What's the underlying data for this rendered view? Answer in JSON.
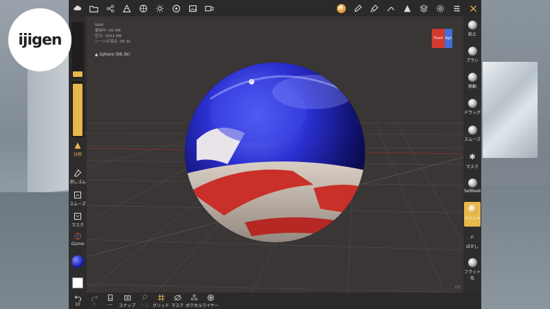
{
  "brand": {
    "logo_text": "ijigen"
  },
  "info": {
    "ram": "RAM",
    "used": "使用中: 66 MB",
    "free": "空き: 1652 MB",
    "scene_verts": "シーンの頂点: 98.3k",
    "scene_item": "Sphere (98.3k)"
  },
  "viewcube": {
    "front": "Front",
    "right": "Rgh"
  },
  "leftbar": {
    "symmetry": "対称",
    "eraser": "消しゴム",
    "smooth": "スムーズ",
    "mask": "マスク",
    "gizmo": "Gizmo"
  },
  "rightbar": {
    "items": [
      {
        "label": "粘土",
        "icon": "clay-ball-icon"
      },
      {
        "label": "ブラシ",
        "icon": "brush-ball-icon"
      },
      {
        "label": "移動",
        "icon": "move-ball-icon"
      },
      {
        "label": "ドラッグ",
        "icon": "drag-ball-icon"
      },
      {
        "label": "スムーズ",
        "icon": "smooth-ball-icon"
      },
      {
        "label": "マスク",
        "icon": "mask-icon"
      },
      {
        "label": "SelMask",
        "icon": "selmask-ball-icon"
      },
      {
        "label": "ペイント",
        "icon": "paint-ball-icon",
        "active": true
      },
      {
        "label": "ぼかし",
        "icon": "blur-icon"
      },
      {
        "label": "フラット化",
        "icon": "flatten-ball-icon"
      }
    ]
  },
  "bottombar": {
    "undo_count": "10",
    "redo_count": "0",
    "items": [
      "スナップ",
      "ソロ",
      "グリッド",
      "マスク",
      "ボクセル",
      "ワイヤー"
    ],
    "dash": "---"
  },
  "colors": {
    "accent": "#e7b94a",
    "panel": "#2e2c2c",
    "viewport": "#3a3636"
  },
  "corner_label": "LT1"
}
